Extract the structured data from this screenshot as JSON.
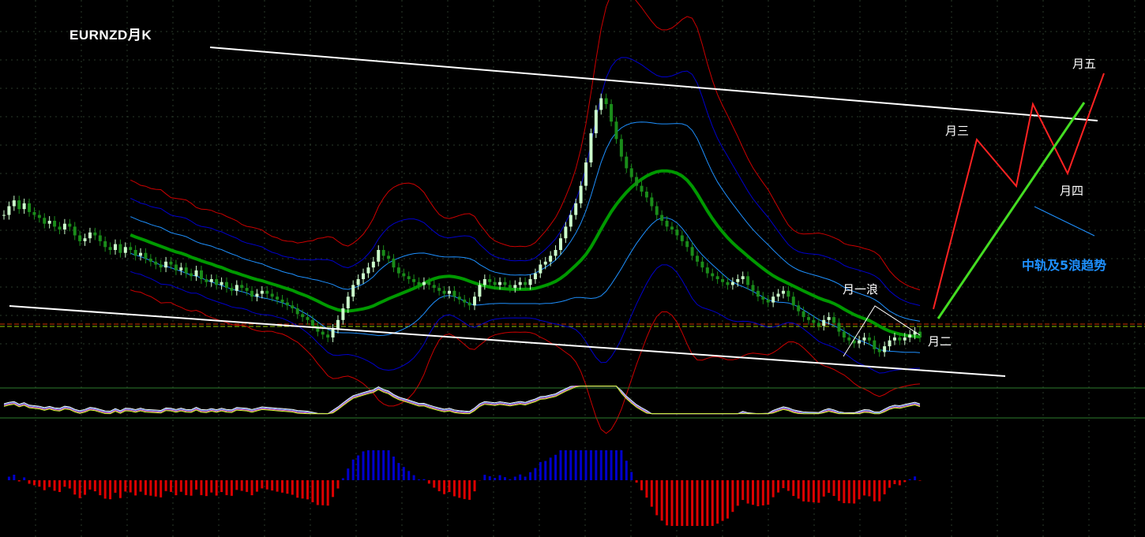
{
  "chart_data": {
    "type": "candlestick",
    "title": "EURNZD月K",
    "series_close": [
      1.56,
      1.575,
      1.585,
      1.57,
      1.58,
      1.565,
      1.56,
      1.555,
      1.545,
      1.55,
      1.54,
      1.535,
      1.545,
      1.54,
      1.525,
      1.515,
      1.52,
      1.53,
      1.525,
      1.515,
      1.505,
      1.5,
      1.51,
      1.495,
      1.505,
      1.5,
      1.49,
      1.495,
      1.485,
      1.48,
      1.475,
      1.47,
      1.48,
      1.475,
      1.465,
      1.47,
      1.46,
      1.455,
      1.465,
      1.45,
      1.445,
      1.45,
      1.44,
      1.445,
      1.435,
      1.43,
      1.44,
      1.435,
      1.43,
      1.42,
      1.425,
      1.43,
      1.425,
      1.42,
      1.415,
      1.41,
      1.405,
      1.4,
      1.39,
      1.385,
      1.38,
      1.37,
      1.36,
      1.355,
      1.35,
      1.365,
      1.38,
      1.4,
      1.42,
      1.44,
      1.45,
      1.46,
      1.47,
      1.48,
      1.5,
      1.49,
      1.485,
      1.47,
      1.46,
      1.455,
      1.45,
      1.445,
      1.44,
      1.445,
      1.44,
      1.435,
      1.43,
      1.425,
      1.43,
      1.42,
      1.415,
      1.41,
      1.405,
      1.42,
      1.44,
      1.45,
      1.445,
      1.44,
      1.445,
      1.44,
      1.435,
      1.44,
      1.445,
      1.44,
      1.45,
      1.46,
      1.475,
      1.48,
      1.49,
      1.5,
      1.52,
      1.54,
      1.56,
      1.58,
      1.61,
      1.65,
      1.7,
      1.74,
      1.76,
      1.75,
      1.72,
      1.69,
      1.66,
      1.64,
      1.625,
      1.61,
      1.6,
      1.59,
      1.575,
      1.56,
      1.55,
      1.54,
      1.535,
      1.525,
      1.515,
      1.505,
      1.49,
      1.48,
      1.47,
      1.46,
      1.455,
      1.45,
      1.445,
      1.44,
      1.445,
      1.45,
      1.455,
      1.44,
      1.43,
      1.42,
      1.415,
      1.41,
      1.42,
      1.425,
      1.43,
      1.42,
      1.405,
      1.395,
      1.385,
      1.38,
      1.375,
      1.37,
      1.38,
      1.385,
      1.375,
      1.36,
      1.35,
      1.345,
      1.34,
      1.345,
      1.35,
      1.345,
      1.33,
      1.325,
      1.335,
      1.345,
      1.35,
      1.345,
      1.35,
      1.355,
      1.36,
      1.35
    ],
    "projection": [
      "月三",
      "月四",
      "月五"
    ],
    "annotations": {
      "wave1": "月一浪",
      "wave2": "月二",
      "wave3": "月三",
      "wave4": "月四",
      "wave5": "月五",
      "trend_note": "中轨及5浪趋势"
    },
    "colors": {
      "bull_candle": "#ccffcc",
      "bear_candle": "#1a8c1a",
      "mid_band": "#009900",
      "band_inner": "#1e90ff",
      "band_mid": "#0000cc",
      "band_outer": "#cc0000",
      "macd_pos": "#0000cc",
      "macd_neg": "#dd0000",
      "projection_red": "#ff2222",
      "projection_green": "#44dd22",
      "channel": "#ffffff"
    }
  }
}
